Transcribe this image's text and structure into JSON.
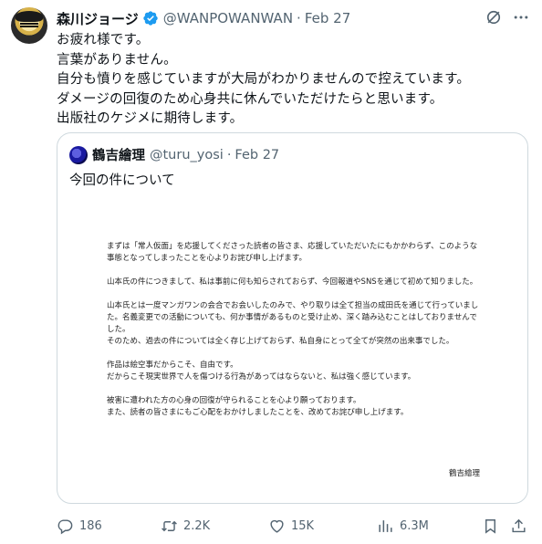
{
  "post": {
    "author_name": "森川ジョージ",
    "handle": "@WANPOWANWAN",
    "separator": "·",
    "date": "Feb 27",
    "text": "お疲れ様です。\n言葉がありません。\n自分も憤りを感じていますが大局がわかりませんので控えています。\nダメージの回復のため心身共に休んでいただけたらと思います。\n出版社のケジメに期待します。",
    "icons": {
      "verified": "verified-badge-icon",
      "grok": "grok-icon",
      "more": "more-icon"
    }
  },
  "quote": {
    "author_name": "鶴吉繪理",
    "handle": "@turu_yosi",
    "separator": "·",
    "date": "Feb 27",
    "text": "今回の件について",
    "statement": [
      "まずは「常人仮面」を応援してくださった読者の皆さま、応援していただいたにもかかわらず、このような事態となってしまったことを心よりお詫び申し上げます。",
      "山本氏の件につきまして、私は事前に何も知らされておらず、今回報道やSNSを通じて初めて知りました。",
      "山本氏とは一度マンガワンの会合でお会いしたのみで、やり取りは全て担当の成田氏を通じて行っていました。名義変更での活動についても、何か事情があるものと受け止め、深く踏み込むことはしておりませんでした。\nそのため、過去の件については全く存じ上げておらず、私自身にとって全てが突然の出来事でした。",
      "作品は絵空事だからこそ、自由です。\nだからこそ現実世界で人を傷つける行為があってはならないと、私は強く感じています。",
      "被害に遭われた方の心身の回復が守られることを心より願っております。\nまた、読者の皆さまにもご心配をおかけしましたことを、改めてお詫び申し上げます。"
    ],
    "signature": "鶴吉繪理"
  },
  "actions": {
    "replies": "186",
    "reposts": "2.2K",
    "likes": "15K",
    "views": "6.3M",
    "icons": [
      "reply-icon",
      "repost-icon",
      "like-icon",
      "views-icon",
      "bookmark-icon",
      "share-icon"
    ]
  },
  "colors": {
    "text": "#0f1419",
    "muted": "#536471",
    "verified": "#1d9bf0",
    "border": "#cfd9de"
  }
}
